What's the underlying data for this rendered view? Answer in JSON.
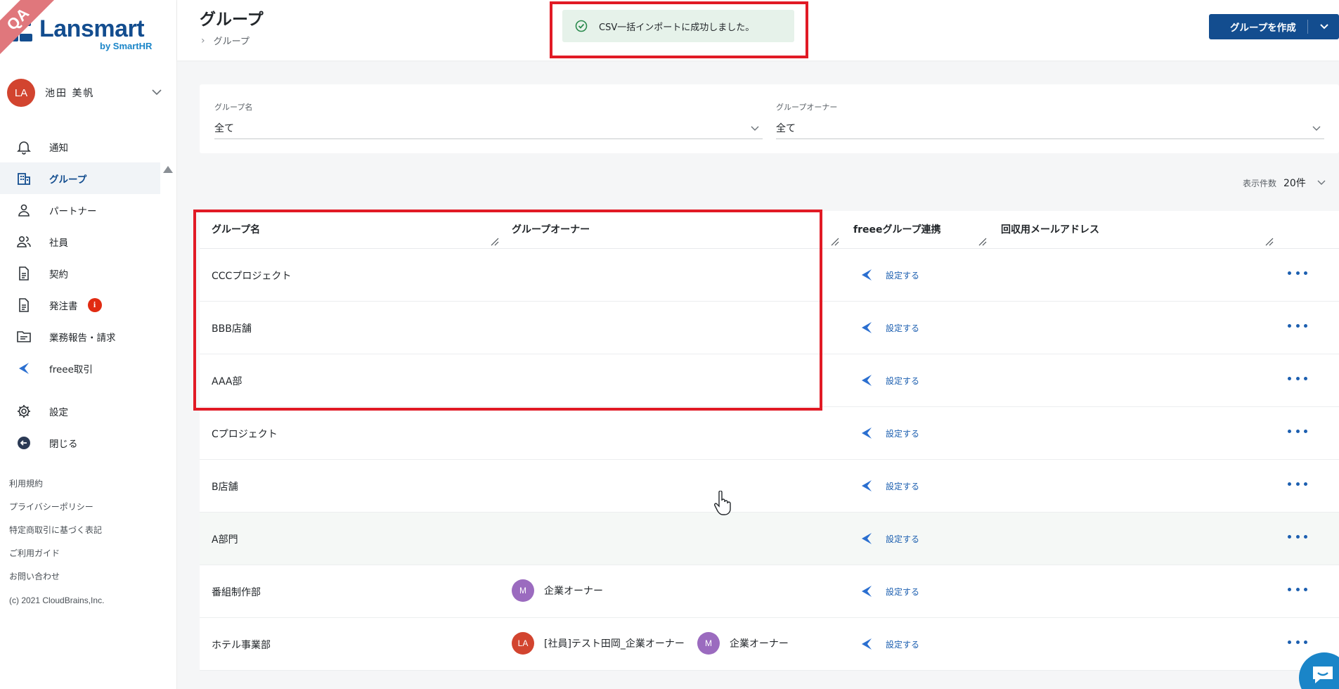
{
  "badge": {
    "qa": "QA"
  },
  "brand": {
    "name": "Lansmart",
    "sub": "by SmartHR"
  },
  "user": {
    "initials": "LA",
    "name": "池田 美帆"
  },
  "nav": [
    {
      "label": "通知",
      "icon": "bell-icon"
    },
    {
      "label": "グループ",
      "icon": "building-icon",
      "active": true
    },
    {
      "label": "パートナー",
      "icon": "person-icon"
    },
    {
      "label": "社員",
      "icon": "people-icon"
    },
    {
      "label": "契約",
      "icon": "document-icon"
    },
    {
      "label": "発注書",
      "icon": "document-icon",
      "badge": "i"
    },
    {
      "label": "業務報告・請求",
      "icon": "folder-icon"
    },
    {
      "label": "freee取引",
      "icon": "freee-icon"
    },
    {
      "label": "設定",
      "icon": "gear-icon"
    },
    {
      "label": "閉じる",
      "icon": "collapse-icon"
    }
  ],
  "footer": {
    "links": [
      "利用規約",
      "プライバシーポリシー",
      "特定商取引に基づく表記",
      "ご利用ガイド",
      "お問い合わせ"
    ],
    "copyright": "(c) 2021 CloudBrains,Inc."
  },
  "header": {
    "title": "グループ",
    "breadcrumb": "グループ",
    "create_button": "グループを作成"
  },
  "toast": {
    "message": "CSV一括インポートに成功しました。"
  },
  "filters": {
    "group_name": {
      "label": "グループ名",
      "value": "全て"
    },
    "group_owner": {
      "label": "グループオーナー",
      "value": "全て"
    }
  },
  "pagination": {
    "per_page_label": "表示件数",
    "per_page_value": "20件"
  },
  "table": {
    "columns": [
      "グループ名",
      "グループオーナー",
      "freeeグループ連携",
      "回収用メールアドレス"
    ],
    "freee_link_label": "設定する",
    "rows": [
      {
        "name": "CCCプロジェクト",
        "owners": []
      },
      {
        "name": "BBB店舗",
        "owners": []
      },
      {
        "name": "AAA部",
        "owners": []
      },
      {
        "name": "Cプロジェクト",
        "owners": []
      },
      {
        "name": "B店舗",
        "owners": []
      },
      {
        "name": "A部門",
        "owners": []
      },
      {
        "name": "番組制作部",
        "owners": [
          {
            "initials": "M",
            "name": "企業オーナー",
            "color": "#9b6bbf"
          }
        ]
      },
      {
        "name": "ホテル事業部",
        "owners": [
          {
            "initials": "LA",
            "name": "[社員]テスト田岡_企業オーナー",
            "color": "#d2442f"
          },
          {
            "initials": "M",
            "name": "企業オーナー",
            "color": "#9b6bbf"
          }
        ]
      }
    ]
  },
  "colors": {
    "brand": "#134d8f",
    "accent": "#1a85c8",
    "highlight": "#e11a25",
    "link": "#1c5fb0"
  }
}
